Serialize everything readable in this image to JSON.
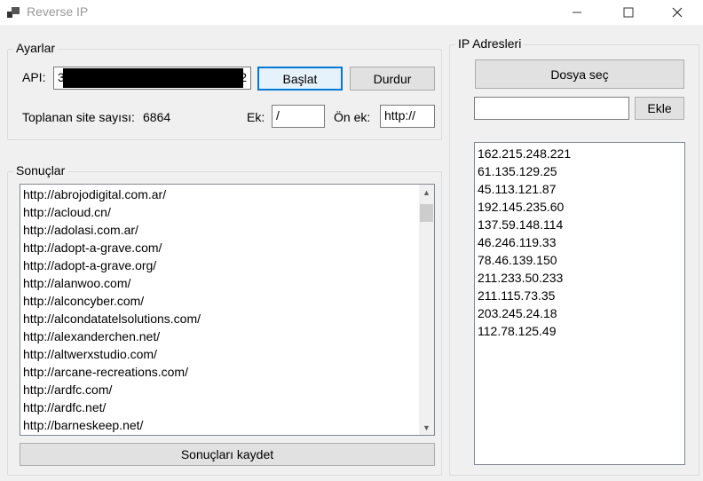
{
  "window": {
    "title": "Reverse IP",
    "min_glyph": "—",
    "max_glyph": "☐",
    "close_glyph": "✕"
  },
  "settings": {
    "legend": "Ayarlar",
    "api_label": "API:",
    "api_prefix": "3",
    "api_suffix": "32",
    "start_button": "Başlat",
    "stop_button": "Durdur",
    "collected_label": "Toplanan site sayısı:",
    "collected_count": "6864",
    "suffix_label": "Ek:",
    "suffix_value": "/",
    "prefix_label": "Ön ek:",
    "prefix_value": "http://"
  },
  "results": {
    "legend": "Sonuçlar",
    "items": [
      "http://abrojodigital.com.ar/",
      "http://acloud.cn/",
      "http://adolasi.com.ar/",
      "http://adopt-a-grave.com/",
      "http://adopt-a-grave.org/",
      "http://alanwoo.com/",
      "http://alconcyber.com/",
      "http://alcondatatelsolutions.com/",
      "http://alexanderchen.net/",
      "http://altwerxstudio.com/",
      "http://arcane-recreations.com/",
      "http://ardfc.com/",
      "http://ardfc.net/",
      "http://barneskeep.net/"
    ],
    "save_button": "Sonuçları kaydet"
  },
  "ip": {
    "legend": "IP Adresleri",
    "choose_file_button": "Dosya seç",
    "add_input_value": "",
    "add_button": "Ekle",
    "addresses": [
      "162.215.248.221",
      "61.135.129.25",
      "45.113.121.87",
      "192.145.235.60",
      "137.59.148.114",
      "46.246.119.33",
      "78.46.139.150",
      "211.233.50.233",
      "211.115.73.35",
      "203.245.24.18",
      "112.78.125.49"
    ]
  },
  "colors": {
    "focus_border": "#0078d7",
    "redaction": "#000000"
  }
}
